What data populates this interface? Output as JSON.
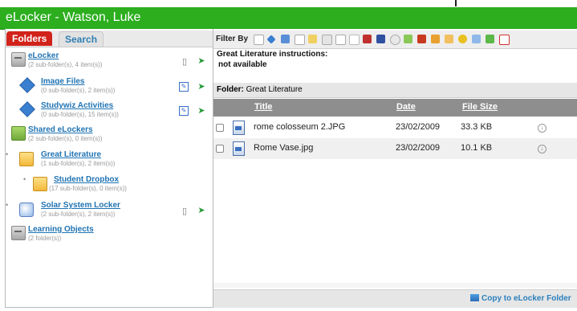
{
  "app": {
    "title": "eLocker - Watson, Luke"
  },
  "tabs": {
    "folders": "Folders",
    "search": "Search"
  },
  "tree": [
    {
      "name": "eLocker",
      "meta": "(2 sub-folder(s), 4 item(s))",
      "icon": "locker-icon"
    },
    {
      "name": "Image Files",
      "meta": "(0 sub-folder(s), 2 item(s))",
      "icon": "diamond-icon"
    },
    {
      "name": "Studywiz Activities",
      "meta": "(0 sub-folder(s), 15 item(s))",
      "icon": "diamond-icon"
    },
    {
      "name": "Shared eLockers",
      "meta": "(2 sub-folder(s), 0 item(s))",
      "icon": "shared-locker-icon"
    },
    {
      "name": "Great Literature",
      "meta": "(1 sub-folder(s), 2 item(s))",
      "icon": "folder-icon"
    },
    {
      "name": "Student Dropbox",
      "meta": "(17 sub-folder(s), 0 item(s))",
      "icon": "dropbox-icon"
    },
    {
      "name": "Solar System Locker",
      "meta": "(2 sub-folder(s), 2 item(s))",
      "icon": "solar-locker-icon"
    },
    {
      "name": "Learning Objects",
      "meta": "(2 folder(s))",
      "icon": "locker-icon"
    }
  ],
  "filter": {
    "label": "Filter By"
  },
  "instructions": {
    "heading": "Great Literature instructions:",
    "value": "not available"
  },
  "folder": {
    "label": "Folder:",
    "name": "Great Literature"
  },
  "columns": {
    "title": "Title",
    "date": "Date",
    "size": "File Size"
  },
  "files": [
    {
      "title": "rome colosseum 2.JPG",
      "date": "23/02/2009",
      "size": "33.3 KB"
    },
    {
      "title": "Rome Vase.jpg",
      "date": "23/02/2009",
      "size": "10.1 KB"
    }
  ],
  "actions": {
    "copy": "Copy to eLocker Folder"
  },
  "colors": {
    "titlebar": "#2cae1f",
    "active_tab": "#d2231b",
    "link": "#1f73b3",
    "column_header": "#8e8e8e"
  }
}
